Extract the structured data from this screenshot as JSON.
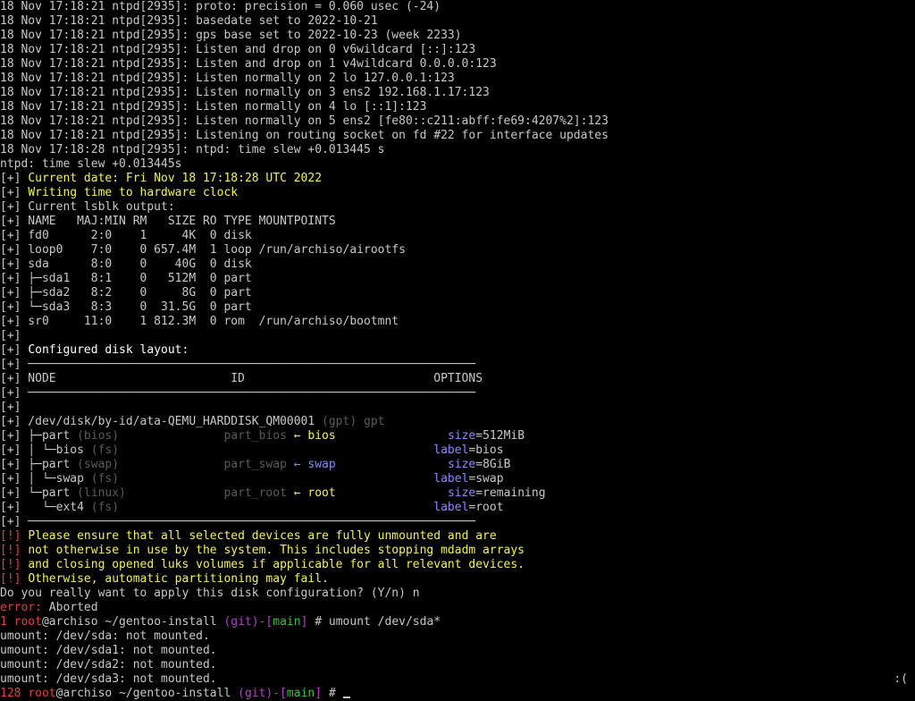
{
  "colors": {
    "yellow": "#f2f25a",
    "grey": "#5a5a5a",
    "blue": "#8a8aff",
    "red": "#e04040",
    "magenta": "#b040c0",
    "green": "#3cc03c"
  },
  "lines": [
    [
      [
        "w",
        "18 Nov 17:18:21 ntpd[2935]: proto: precision = 0.060 usec (-24)"
      ]
    ],
    [
      [
        "w",
        "18 Nov 17:18:21 ntpd[2935]: basedate set to 2022-10-21"
      ]
    ],
    [
      [
        "w",
        "18 Nov 17:18:21 ntpd[2935]: gps base set to 2022-10-23 (week 2233)"
      ]
    ],
    [
      [
        "w",
        "18 Nov 17:18:21 ntpd[2935]: Listen and drop on 0 v6wildcard [::]:123"
      ]
    ],
    [
      [
        "w",
        "18 Nov 17:18:21 ntpd[2935]: Listen and drop on 1 v4wildcard 0.0.0.0:123"
      ]
    ],
    [
      [
        "w",
        "18 Nov 17:18:21 ntpd[2935]: Listen normally on 2 lo 127.0.0.1:123"
      ]
    ],
    [
      [
        "w",
        "18 Nov 17:18:21 ntpd[2935]: Listen normally on 3 ens2 192.168.1.17:123"
      ]
    ],
    [
      [
        "w",
        "18 Nov 17:18:21 ntpd[2935]: Listen normally on 4 lo [::1]:123"
      ]
    ],
    [
      [
        "w",
        "18 Nov 17:18:21 ntpd[2935]: Listen normally on 5 ens2 [fe80::c211:abff:fe69:4207%2]:123"
      ]
    ],
    [
      [
        "w",
        "18 Nov 17:18:21 ntpd[2935]: Listening on routing socket on fd #22 for interface updates"
      ]
    ],
    [
      [
        "w",
        "18 Nov 17:18:28 ntpd[2935]: ntpd: time slew +0.013445 s"
      ]
    ],
    [
      [
        "w",
        "ntpd: time slew +0.013445s"
      ]
    ],
    [
      [
        "w",
        "[+] "
      ],
      [
        "y",
        "Current date: Fri Nov 18 17:18:28 UTC 2022"
      ]
    ],
    [
      [
        "w",
        "[+] "
      ],
      [
        "y",
        "Writing time to hardware clock"
      ]
    ],
    [
      [
        "w",
        "[+] Current lsblk output:"
      ]
    ],
    [
      [
        "w",
        "[+] NAME   MAJ:MIN RM   SIZE RO TYPE MOUNTPOINTS"
      ]
    ],
    [
      [
        "w",
        "[+] fd0      2:0    1     4K  0 disk"
      ]
    ],
    [
      [
        "w",
        "[+] loop0    7:0    0 657.4M  1 loop /run/archiso/airootfs"
      ]
    ],
    [
      [
        "w",
        "[+] sda      8:0    0    40G  0 disk"
      ]
    ],
    [
      [
        "w",
        "[+] ├─sda1   8:1    0   512M  0 part"
      ]
    ],
    [
      [
        "w",
        "[+] ├─sda2   8:2    0     8G  0 part"
      ]
    ],
    [
      [
        "w",
        "[+] └─sda3   8:3    0  31.5G  0 part"
      ]
    ],
    [
      [
        "w",
        "[+] sr0     11:0    1 812.3M  0 rom  /run/archiso/bootmnt"
      ]
    ],
    [
      [
        "w",
        "[+]"
      ]
    ],
    [
      [
        "w",
        "[+] "
      ],
      [
        "b",
        "Configured disk layout:"
      ]
    ],
    [
      [
        "w",
        "[+] ────────────────────────────────────────────────────────────────"
      ]
    ],
    [
      [
        "w",
        "[+] NODE                         ID                           OPTIONS"
      ]
    ],
    [
      [
        "w",
        "[+] ────────────────────────────────────────────────────────────────"
      ]
    ],
    [
      [
        "w",
        "[+]"
      ]
    ],
    [
      [
        "w",
        "[+] /dev/disk/by-id/ata-QEMU_HARDDISK_QM00001 "
      ],
      [
        "g",
        "(gpt) gpt"
      ]
    ],
    [
      [
        "w",
        "[+] ├─part "
      ],
      [
        "g",
        "(bios)"
      ],
      [
        "w",
        "               "
      ],
      [
        "g",
        "part_bios"
      ],
      [
        "w",
        " "
      ],
      [
        "y",
        "← bios"
      ],
      [
        "w",
        "                "
      ],
      [
        "bl",
        "size"
      ],
      [
        "w",
        "=512MiB"
      ]
    ],
    [
      [
        "w",
        "[+] │ └─bios "
      ],
      [
        "g",
        "(fs)"
      ],
      [
        "w",
        "                                             "
      ],
      [
        "bl",
        "label"
      ],
      [
        "w",
        "=bios"
      ]
    ],
    [
      [
        "w",
        "[+] ├─part "
      ],
      [
        "g",
        "(swap)"
      ],
      [
        "w",
        "               "
      ],
      [
        "g",
        "part_swap"
      ],
      [
        "w",
        " "
      ],
      [
        "bl",
        "← swap"
      ],
      [
        "w",
        "                "
      ],
      [
        "bl",
        "size"
      ],
      [
        "w",
        "=8GiB"
      ]
    ],
    [
      [
        "w",
        "[+] │ └─swap "
      ],
      [
        "g",
        "(fs)"
      ],
      [
        "w",
        "                                             "
      ],
      [
        "bl",
        "label"
      ],
      [
        "w",
        "=swap"
      ]
    ],
    [
      [
        "w",
        "[+] └─part "
      ],
      [
        "g",
        "(linux)"
      ],
      [
        "w",
        "              "
      ],
      [
        "g",
        "part_root"
      ],
      [
        "w",
        " "
      ],
      [
        "y",
        "← root"
      ],
      [
        "w",
        "                "
      ],
      [
        "bl",
        "size"
      ],
      [
        "w",
        "=remaining"
      ]
    ],
    [
      [
        "w",
        "[+]   └─ext4 "
      ],
      [
        "g",
        "(fs)"
      ],
      [
        "w",
        "                                             "
      ],
      [
        "bl",
        "label"
      ],
      [
        "w",
        "=root"
      ]
    ],
    [
      [
        "w",
        "[+] ────────────────────────────────────────────────────────────────"
      ]
    ],
    [
      [
        "r",
        "[!] "
      ],
      [
        "y",
        "Please ensure that all selected devices are fully unmounted and are"
      ]
    ],
    [
      [
        "r",
        "[!] "
      ],
      [
        "y",
        "not otherwise in use by the system. This includes stopping mdadm arrays"
      ]
    ],
    [
      [
        "r",
        "[!] "
      ],
      [
        "y",
        "and closing opened luks volumes if applicable for all relevant devices."
      ]
    ],
    [
      [
        "r",
        "[!] "
      ],
      [
        "y",
        "Otherwise, automatic partitioning may fail."
      ]
    ],
    [
      [
        "w",
        "Do you really want to apply this disk configuration? (Y/n) n"
      ]
    ],
    [
      [
        "r",
        "error:"
      ],
      [
        "w",
        " Aborted"
      ]
    ],
    [
      [
        "r",
        "1"
      ],
      [
        "w",
        " "
      ],
      [
        "r",
        "root"
      ],
      [
        "w",
        "@archiso ~/gentoo-install "
      ],
      [
        "m",
        "(git)-["
      ],
      [
        "gr",
        "main"
      ],
      [
        "m",
        "]"
      ],
      [
        "w",
        " # umount /dev/sda*"
      ]
    ],
    [
      [
        "w",
        "umount: /dev/sda: not mounted."
      ]
    ],
    [
      [
        "w",
        "umount: /dev/sda1: not mounted."
      ]
    ],
    [
      [
        "w",
        "umount: /dev/sda2: not mounted."
      ]
    ],
    [
      [
        "w",
        "umount: /dev/sda3: not mounted."
      ]
    ],
    [
      [
        "r",
        "128"
      ],
      [
        "w",
        " "
      ],
      [
        "r",
        "root"
      ],
      [
        "w",
        "@archiso ~/gentoo-install "
      ],
      [
        "m",
        "(git)-["
      ],
      [
        "gr",
        "main"
      ],
      [
        "m",
        "]"
      ],
      [
        "w",
        " # "
      ]
    ]
  ],
  "status_right": ":("
}
